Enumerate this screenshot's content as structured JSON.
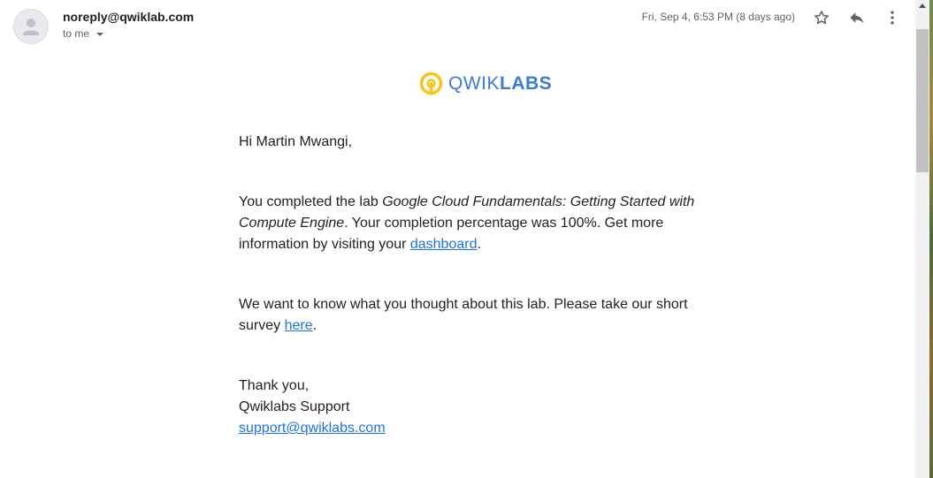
{
  "header": {
    "sender": "noreply@qwiklab.com",
    "recipient_label": "to me",
    "date": "Fri, Sep 4, 6:53 PM (8 days ago)",
    "icons": {
      "avatar": "person-icon",
      "star": "star-icon",
      "reply": "reply-icon",
      "more": "more-vert-icon"
    }
  },
  "logo": {
    "text_light": "QWIK",
    "text_bold": "LABS",
    "brand_color": "#3a7bd5",
    "icon_color": "#f9c21a"
  },
  "email": {
    "greeting": "Hi Martin Mwangi,",
    "para1": {
      "prefix": "You completed the lab ",
      "lab_name": "Google Cloud Fundamentals: Getting Started with Compute Engine",
      "middle": ". Your completion percentage was 100%. Get more information by visiting your ",
      "link_text": "dashboard",
      "suffix": "."
    },
    "para2": {
      "prefix": "We want to know what you thought about this lab. Please take our short survey ",
      "link_text": "here",
      "suffix": "."
    },
    "signature": {
      "closing": "Thank you,",
      "team": "Qwiklabs Support",
      "email": "support@qwiklabs.com"
    },
    "link_color": "#1a73e8"
  }
}
